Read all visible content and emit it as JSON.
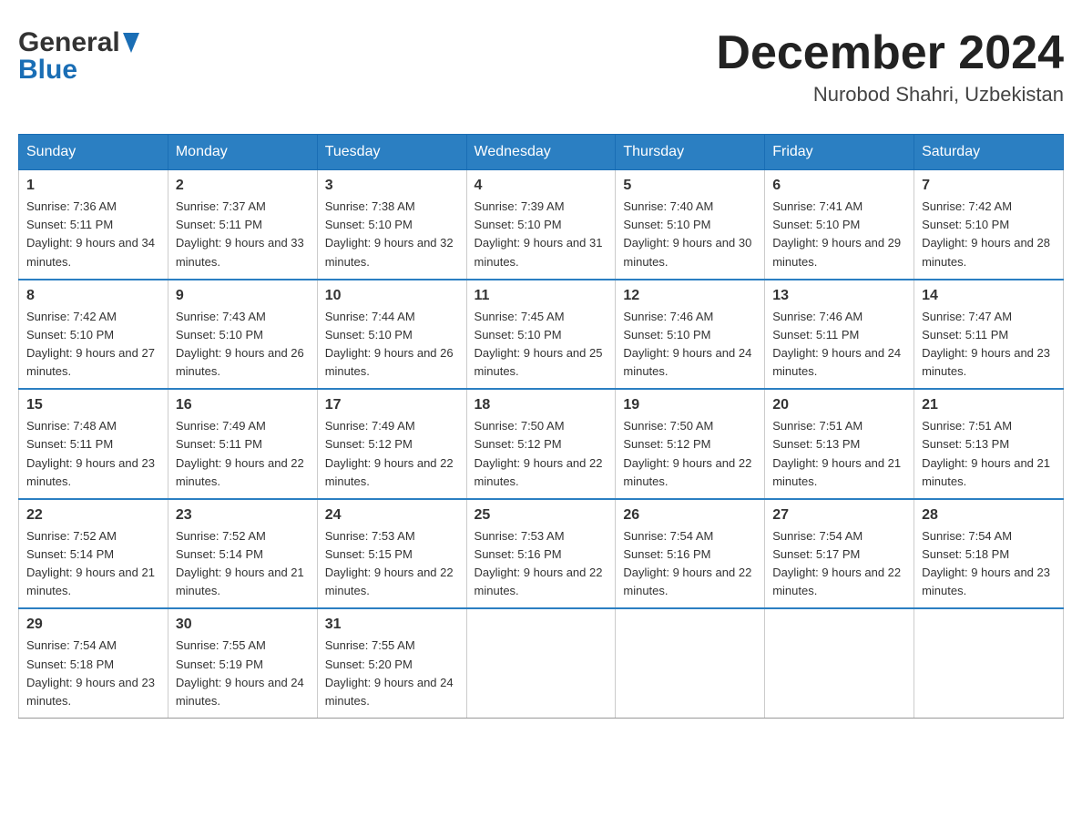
{
  "header": {
    "logo_general": "General",
    "logo_blue": "Blue",
    "month": "December 2024",
    "location": "Nurobod Shahri, Uzbekistan"
  },
  "weekdays": [
    "Sunday",
    "Monday",
    "Tuesday",
    "Wednesday",
    "Thursday",
    "Friday",
    "Saturday"
  ],
  "weeks": [
    [
      {
        "day": "1",
        "sunrise": "7:36 AM",
        "sunset": "5:11 PM",
        "daylight": "9 hours and 34 minutes."
      },
      {
        "day": "2",
        "sunrise": "7:37 AM",
        "sunset": "5:11 PM",
        "daylight": "9 hours and 33 minutes."
      },
      {
        "day": "3",
        "sunrise": "7:38 AM",
        "sunset": "5:10 PM",
        "daylight": "9 hours and 32 minutes."
      },
      {
        "day": "4",
        "sunrise": "7:39 AM",
        "sunset": "5:10 PM",
        "daylight": "9 hours and 31 minutes."
      },
      {
        "day": "5",
        "sunrise": "7:40 AM",
        "sunset": "5:10 PM",
        "daylight": "9 hours and 30 minutes."
      },
      {
        "day": "6",
        "sunrise": "7:41 AM",
        "sunset": "5:10 PM",
        "daylight": "9 hours and 29 minutes."
      },
      {
        "day": "7",
        "sunrise": "7:42 AM",
        "sunset": "5:10 PM",
        "daylight": "9 hours and 28 minutes."
      }
    ],
    [
      {
        "day": "8",
        "sunrise": "7:42 AM",
        "sunset": "5:10 PM",
        "daylight": "9 hours and 27 minutes."
      },
      {
        "day": "9",
        "sunrise": "7:43 AM",
        "sunset": "5:10 PM",
        "daylight": "9 hours and 26 minutes."
      },
      {
        "day": "10",
        "sunrise": "7:44 AM",
        "sunset": "5:10 PM",
        "daylight": "9 hours and 26 minutes."
      },
      {
        "day": "11",
        "sunrise": "7:45 AM",
        "sunset": "5:10 PM",
        "daylight": "9 hours and 25 minutes."
      },
      {
        "day": "12",
        "sunrise": "7:46 AM",
        "sunset": "5:10 PM",
        "daylight": "9 hours and 24 minutes."
      },
      {
        "day": "13",
        "sunrise": "7:46 AM",
        "sunset": "5:11 PM",
        "daylight": "9 hours and 24 minutes."
      },
      {
        "day": "14",
        "sunrise": "7:47 AM",
        "sunset": "5:11 PM",
        "daylight": "9 hours and 23 minutes."
      }
    ],
    [
      {
        "day": "15",
        "sunrise": "7:48 AM",
        "sunset": "5:11 PM",
        "daylight": "9 hours and 23 minutes."
      },
      {
        "day": "16",
        "sunrise": "7:49 AM",
        "sunset": "5:11 PM",
        "daylight": "9 hours and 22 minutes."
      },
      {
        "day": "17",
        "sunrise": "7:49 AM",
        "sunset": "5:12 PM",
        "daylight": "9 hours and 22 minutes."
      },
      {
        "day": "18",
        "sunrise": "7:50 AM",
        "sunset": "5:12 PM",
        "daylight": "9 hours and 22 minutes."
      },
      {
        "day": "19",
        "sunrise": "7:50 AM",
        "sunset": "5:12 PM",
        "daylight": "9 hours and 22 minutes."
      },
      {
        "day": "20",
        "sunrise": "7:51 AM",
        "sunset": "5:13 PM",
        "daylight": "9 hours and 21 minutes."
      },
      {
        "day": "21",
        "sunrise": "7:51 AM",
        "sunset": "5:13 PM",
        "daylight": "9 hours and 21 minutes."
      }
    ],
    [
      {
        "day": "22",
        "sunrise": "7:52 AM",
        "sunset": "5:14 PM",
        "daylight": "9 hours and 21 minutes."
      },
      {
        "day": "23",
        "sunrise": "7:52 AM",
        "sunset": "5:14 PM",
        "daylight": "9 hours and 21 minutes."
      },
      {
        "day": "24",
        "sunrise": "7:53 AM",
        "sunset": "5:15 PM",
        "daylight": "9 hours and 22 minutes."
      },
      {
        "day": "25",
        "sunrise": "7:53 AM",
        "sunset": "5:16 PM",
        "daylight": "9 hours and 22 minutes."
      },
      {
        "day": "26",
        "sunrise": "7:54 AM",
        "sunset": "5:16 PM",
        "daylight": "9 hours and 22 minutes."
      },
      {
        "day": "27",
        "sunrise": "7:54 AM",
        "sunset": "5:17 PM",
        "daylight": "9 hours and 22 minutes."
      },
      {
        "day": "28",
        "sunrise": "7:54 AM",
        "sunset": "5:18 PM",
        "daylight": "9 hours and 23 minutes."
      }
    ],
    [
      {
        "day": "29",
        "sunrise": "7:54 AM",
        "sunset": "5:18 PM",
        "daylight": "9 hours and 23 minutes."
      },
      {
        "day": "30",
        "sunrise": "7:55 AM",
        "sunset": "5:19 PM",
        "daylight": "9 hours and 24 minutes."
      },
      {
        "day": "31",
        "sunrise": "7:55 AM",
        "sunset": "5:20 PM",
        "daylight": "9 hours and 24 minutes."
      },
      null,
      null,
      null,
      null
    ]
  ],
  "labels": {
    "sunrise": "Sunrise:",
    "sunset": "Sunset:",
    "daylight": "Daylight:"
  }
}
